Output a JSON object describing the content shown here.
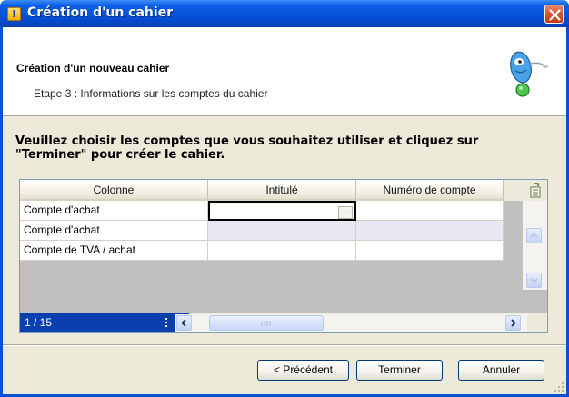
{
  "window": {
    "title": "Création d'un cahier"
  },
  "header": {
    "title": "Création d'un nouveau cahier",
    "subtitle": "Etape 3 : Informations sur les comptes du cahier"
  },
  "instruction": {
    "line1": "Veuillez choisir les comptes que vous souhaitez utiliser et cliquez sur",
    "line2": "\"Terminer\" pour créer le cahier."
  },
  "grid": {
    "columns": [
      "Colonne",
      "Intitulé",
      "Numéro de compte"
    ],
    "rows": [
      {
        "colonne": "Compte d'achat",
        "intitule": "",
        "numero": ""
      },
      {
        "colonne": "Compte d'achat",
        "intitule": "",
        "numero": ""
      },
      {
        "colonne": "Compte de TVA / achat",
        "intitule": "",
        "numero": ""
      }
    ],
    "ellipsis_label": "...",
    "record_counter": "1 / 15"
  },
  "buttons": {
    "previous": "< Précédent",
    "finish": "Terminer",
    "cancel": "Annuler"
  }
}
